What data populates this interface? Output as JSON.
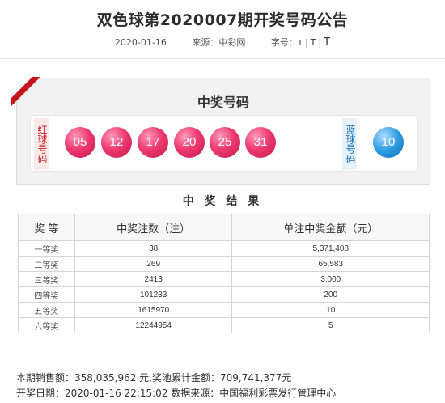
{
  "header": {
    "title": "双色球第2020007期开奖号码公告",
    "date": "2020-01-16",
    "source_label": "来源：中彩网",
    "font_label": "字号：",
    "font_sizes": [
      "T",
      "T",
      "T"
    ]
  },
  "draw": {
    "panel_title": "中奖号码",
    "red_tag": "红球号码",
    "blue_tag": "蓝球号码",
    "red_balls": [
      "05",
      "12",
      "17",
      "20",
      "25",
      "31"
    ],
    "blue_ball": "10",
    "colors": {
      "red_accent": "#c4161c",
      "red_ball": "#ef3a72",
      "blue_ball": "#2d9be2"
    }
  },
  "results": {
    "title": "中 奖 结 果",
    "columns": [
      "奖 等",
      "中奖注数（注）",
      "单注中奖金额（元）"
    ],
    "rows": [
      [
        "一等奖",
        "38",
        "5,371,408"
      ],
      [
        "二等奖",
        "269",
        "65,583"
      ],
      [
        "三等奖",
        "2413",
        "3,000"
      ],
      [
        "四等奖",
        "101233",
        "200"
      ],
      [
        "五等奖",
        "1615970",
        "10"
      ],
      [
        "六等奖",
        "12244954",
        "5"
      ]
    ]
  },
  "footer": {
    "sales": "本期销售额：358,035,962 元,奖池累计金额：709,741,377元",
    "draw_time": "开奖日期：2020-01-16 22:15:02 数据来源：中国福利彩票发行管理中心"
  }
}
